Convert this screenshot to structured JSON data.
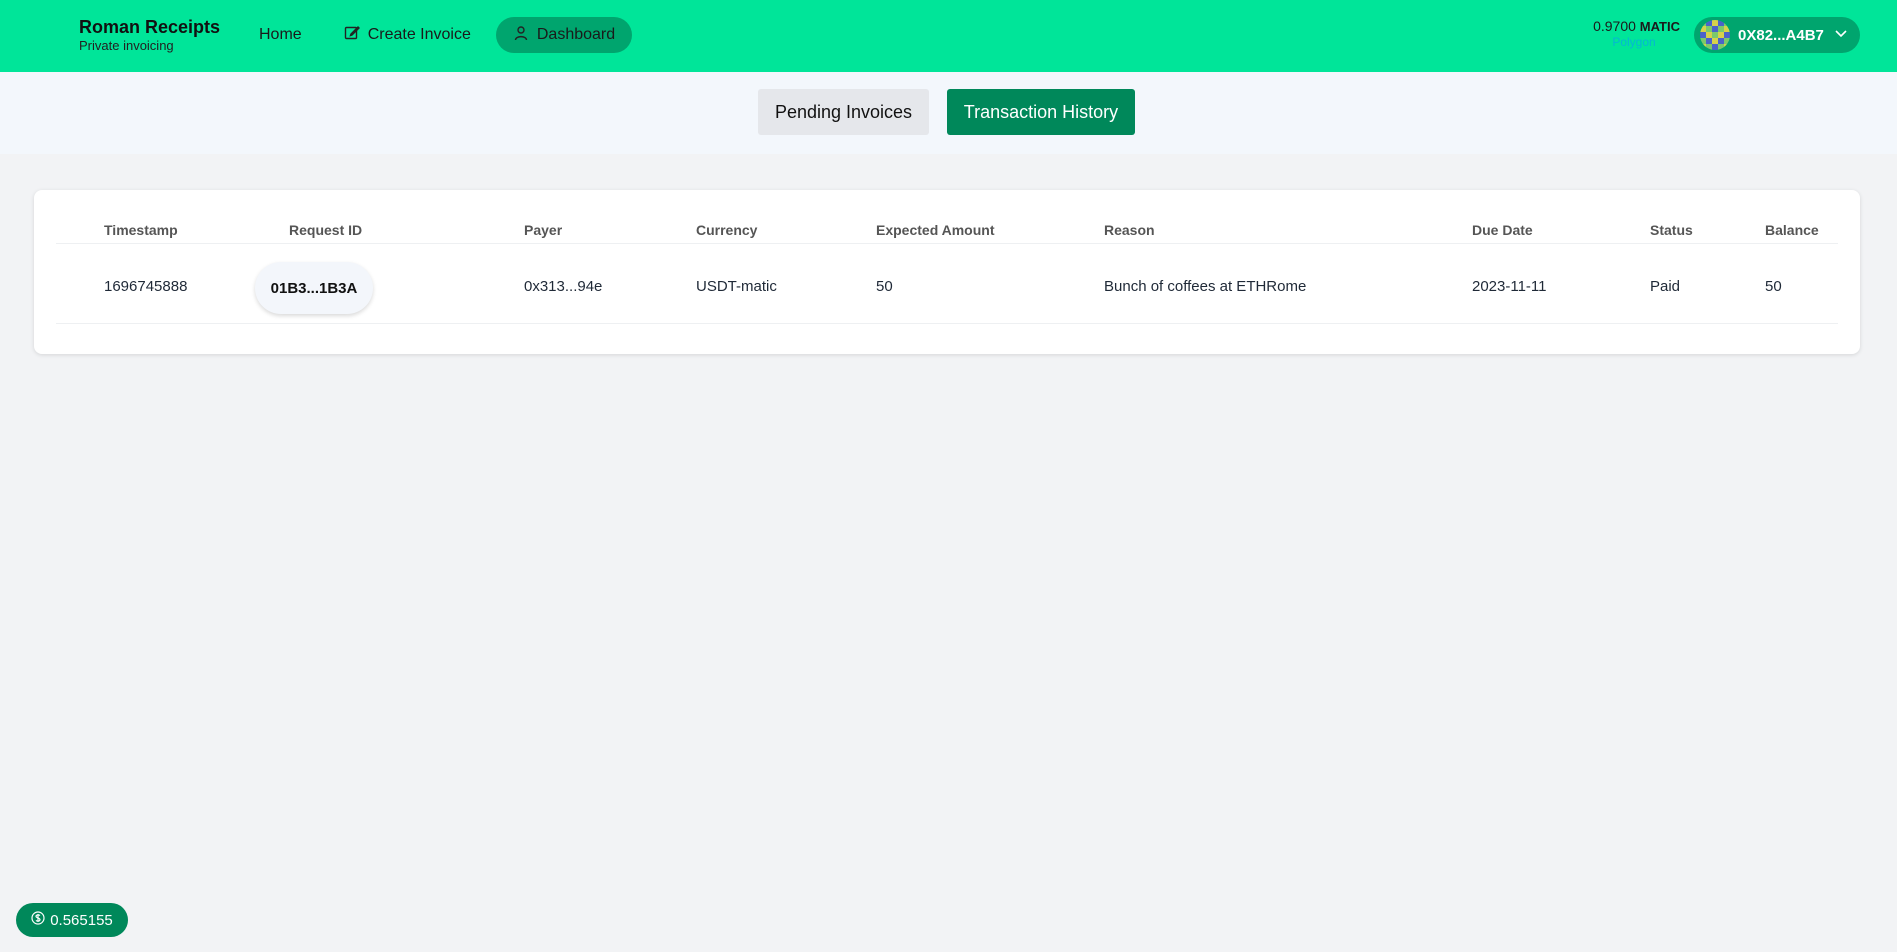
{
  "brand": {
    "title": "Roman Receipts",
    "subtitle": "Private invoicing"
  },
  "nav": {
    "home": "Home",
    "create_invoice": "Create Invoice",
    "dashboard": "Dashboard"
  },
  "wallet": {
    "balance_amount": "0.9700",
    "balance_unit": "MATIC",
    "network": "Polygon",
    "account": "0X82...A4B7"
  },
  "tabs": {
    "pending": "Pending Invoices",
    "history": "Transaction History"
  },
  "table": {
    "headers": [
      "Timestamp",
      "Request ID",
      "Payer",
      "Currency",
      "Expected Amount",
      "Reason",
      "Due Date",
      "Status",
      "Balance"
    ],
    "rows": [
      {
        "timestamp": "1696745888",
        "request_id": "01B3...1B3A",
        "payer": "0x313...94e",
        "currency": "USDT-matic",
        "expected_amount": "50",
        "reason": "Bunch of coffees at ETHRome",
        "due_date": "2023-11-11",
        "status": "Paid",
        "balance": "50"
      }
    ]
  },
  "price_pill": {
    "value": "0.565155"
  },
  "colors": {
    "header": "#00e599",
    "accent": "#00885a",
    "active_nav": "#00a56e"
  }
}
